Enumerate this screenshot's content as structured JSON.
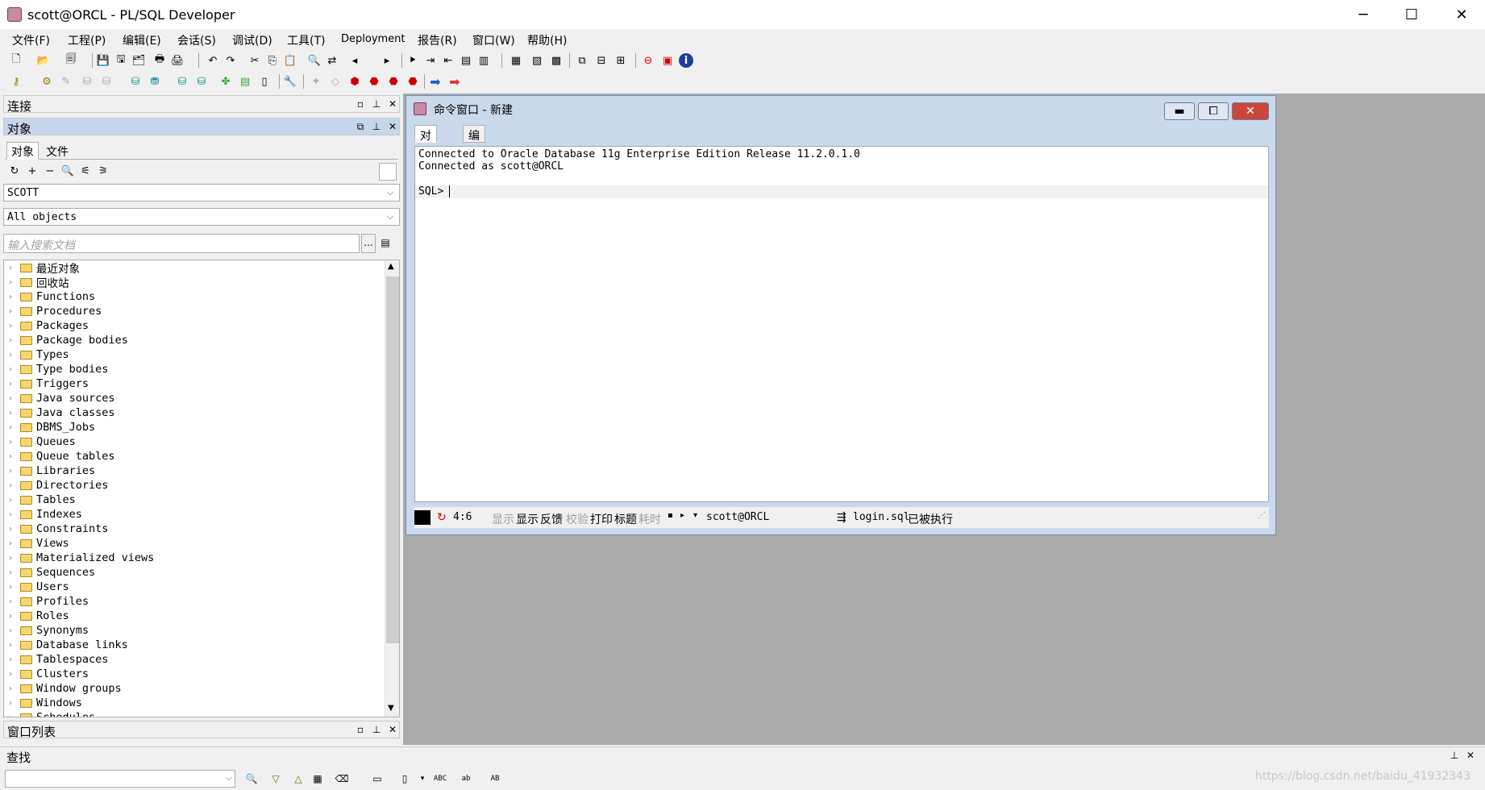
{
  "window": {
    "title": "scott@ORCL - PL/SQL Developer",
    "minimize": "─",
    "maximize": "☐",
    "close": "✕"
  },
  "menu": [
    "文件(F)",
    "工程(P)",
    "编辑(E)",
    "会话(S)",
    "调试(D)",
    "工具(T)",
    "Deployment",
    "报告(R)",
    "窗口(W)",
    "帮助(H)"
  ],
  "panels": {
    "connect_title": "连接",
    "objects_title": "对象",
    "tab_objects": "对象",
    "tab_files": "文件"
  },
  "filters": {
    "owner": "SCOTT",
    "type": "All objects",
    "search_placeholder": "输入搜索文档",
    "search_button": "..."
  },
  "tree_items": [
    "最近对象",
    "回收站",
    "Functions",
    "Procedures",
    "Packages",
    "Package bodies",
    "Types",
    "Type bodies",
    "Triggers",
    "Java sources",
    "Java classes",
    "DBMS_Jobs",
    "Queues",
    "Queue tables",
    "Libraries",
    "Directories",
    "Tables",
    "Indexes",
    "Constraints",
    "Views",
    "Materialized views",
    "Sequences",
    "Users",
    "Profiles",
    "Roles",
    "Synonyms",
    "Database links",
    "Tablespaces",
    "Clusters",
    "Window groups",
    "Windows",
    "Schedules"
  ],
  "winlist_title": "窗口列表",
  "find_title": "查找",
  "command_window": {
    "title": "命令窗口 - 新建",
    "tabs": [
      "对话框",
      "编辑器"
    ],
    "lines": [
      "Connected to Oracle Database 11g Enterprise Edition Release 11.2.0.1.0",
      "Connected as scott@ORCL"
    ],
    "prompt": "SQL>",
    "status": {
      "position": "4:6",
      "display": "显示",
      "show": "显示",
      "feedback": "反馈",
      "verify": "校验",
      "print": "打印",
      "heading": "标题",
      "timing": "耗时",
      "connection": "scott@ORCL",
      "login_file": "login.sql",
      "login_status": "已被执行"
    }
  },
  "watermark": "https://blog.csdn.net/baidu_41932343",
  "colors": {
    "active_header": "#c6d6ea",
    "mdi_background": "#ababab",
    "cmd_window_frame": "#cbd9ec",
    "close_button": "#c9483b"
  }
}
